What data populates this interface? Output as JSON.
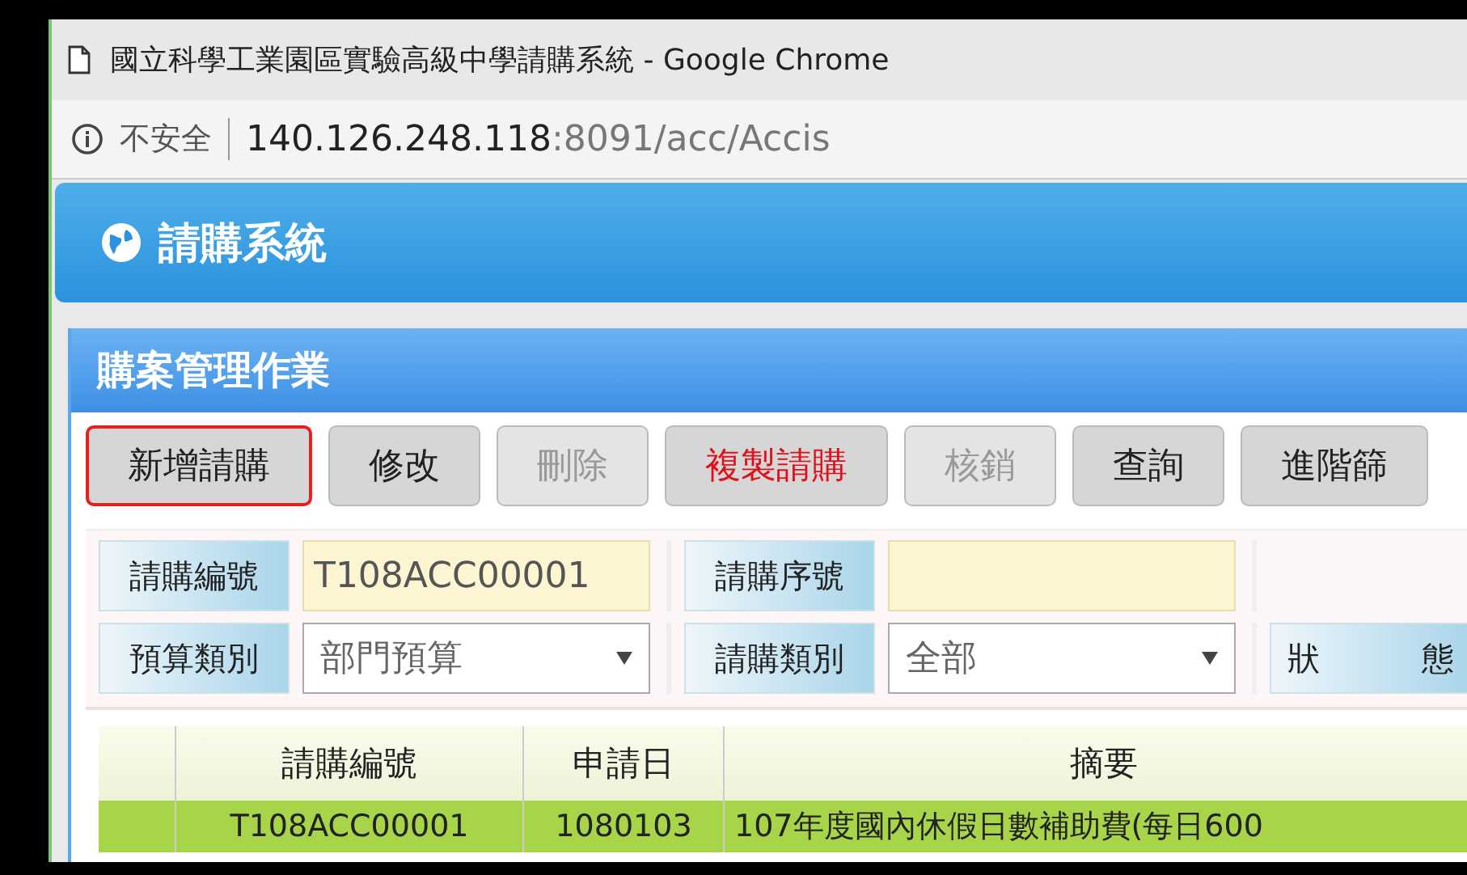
{
  "window": {
    "title": "國立科學工業園區實驗高級中學請購系統 - Google Chrome"
  },
  "address_bar": {
    "security": "不安全",
    "url_host": "140.126.248.118",
    "url_rest": ":8091/acc/Accis"
  },
  "app_header": {
    "title": "請購系統"
  },
  "panel": {
    "title": "購案管理作業",
    "buttons": [
      {
        "label": "新增請購",
        "focused": true,
        "disabled": false,
        "highlighted": false
      },
      {
        "label": "修改",
        "focused": false,
        "disabled": false,
        "highlighted": false
      },
      {
        "label": "刪除",
        "focused": false,
        "disabled": true,
        "highlighted": false
      },
      {
        "label": "複製請購",
        "focused": false,
        "disabled": false,
        "highlighted": true
      },
      {
        "label": "核銷",
        "focused": false,
        "disabled": true,
        "highlighted": false
      },
      {
        "label": "查詢",
        "focused": false,
        "disabled": false,
        "highlighted": false
      },
      {
        "label": "進階篩",
        "focused": false,
        "disabled": false,
        "highlighted": false
      }
    ],
    "form_rows": [
      [
        {
          "kind": "text",
          "label": "請購編號",
          "value": "T108ACC00001"
        },
        {
          "kind": "text",
          "label": "請購序號"
        }
      ],
      [
        {
          "kind": "select",
          "label": "預算類別",
          "value": "部門預算"
        },
        {
          "kind": "select",
          "label": "請購類別",
          "value": "全部"
        },
        {
          "kind": "label",
          "label": "狀 態"
        }
      ]
    ],
    "table": {
      "columns": [
        "請購編號",
        "申請日",
        "摘要"
      ],
      "rows": [
        {
          "selected": true,
          "cells": [
            "T108ACC00001",
            "1080103",
            "107年度國內休假日數補助費(每日600"
          ]
        }
      ]
    }
  }
}
